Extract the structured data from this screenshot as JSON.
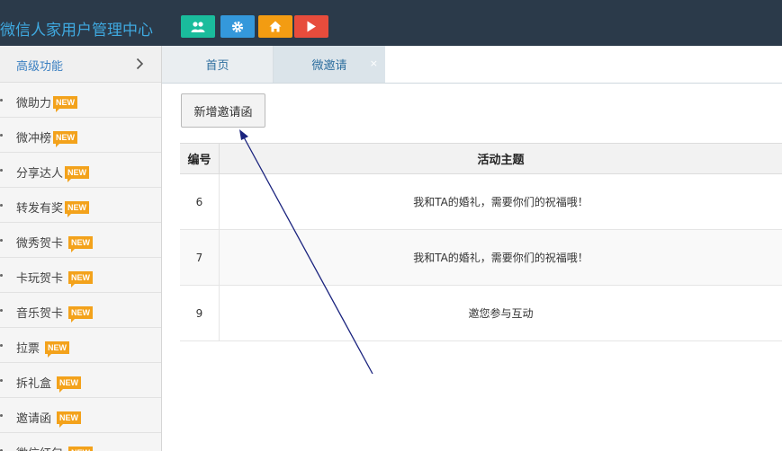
{
  "header": {
    "brand": "微信人家用户管理中心",
    "buttons": [
      {
        "icon": "users-icon",
        "color": "#1abc9c"
      },
      {
        "icon": "gear-icon",
        "color": "#3498db"
      },
      {
        "icon": "home-icon",
        "color": "#f39c12"
      },
      {
        "icon": "play-icon",
        "color": "#e74c3c"
      }
    ]
  },
  "sidebar": {
    "section_label": "高级功能",
    "badge": "NEW",
    "items": [
      {
        "label": "微助力"
      },
      {
        "label": "微冲榜"
      },
      {
        "label": "分享达人"
      },
      {
        "label": "转发有奖"
      },
      {
        "label": "微秀贺卡"
      },
      {
        "label": "卡玩贺卡"
      },
      {
        "label": "音乐贺卡"
      },
      {
        "label": "拉票"
      },
      {
        "label": "拆礼盒"
      },
      {
        "label": "邀请函"
      },
      {
        "label": "微信红包"
      }
    ]
  },
  "tabs": [
    {
      "label": "首页"
    },
    {
      "label": "微邀请",
      "close": "×"
    }
  ],
  "toolbar": {
    "add_label": "新增邀请函"
  },
  "table": {
    "headers": [
      "编号",
      "活动主题"
    ],
    "rows": [
      {
        "id": "6",
        "title": "我和TA的婚礼，需要你们的祝福哦！"
      },
      {
        "id": "7",
        "title": "我和TA的婚礼，需要你们的祝福哦！"
      },
      {
        "id": "9",
        "title": "邀您参与互动"
      }
    ]
  },
  "annotation": {
    "color": "#1a237e"
  }
}
